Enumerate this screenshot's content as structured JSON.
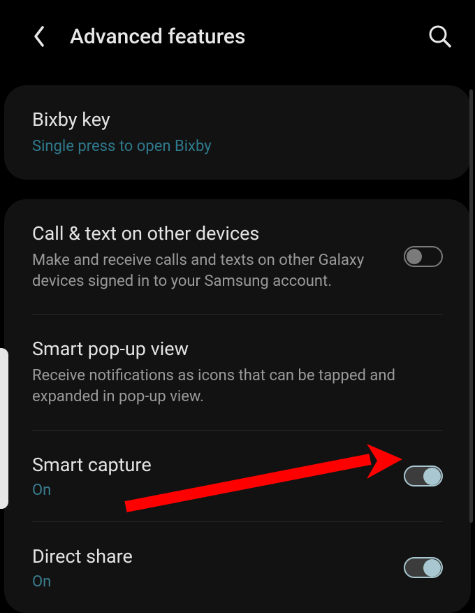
{
  "header": {
    "title": "Advanced features"
  },
  "card1": {
    "item1": {
      "title": "Bixby key",
      "desc": "Single press to open Bixby"
    }
  },
  "card2": {
    "item1": {
      "title": "Call & text on other devices",
      "desc": "Make and receive calls and texts on other Galaxy devices signed in to your Samsung account."
    },
    "item2": {
      "title": "Smart pop-up view",
      "desc": "Receive notifications as icons that can be tapped and expanded in pop-up view."
    },
    "item3": {
      "title": "Smart capture",
      "status": "On"
    },
    "item4": {
      "title": "Direct share",
      "status": "On"
    }
  }
}
